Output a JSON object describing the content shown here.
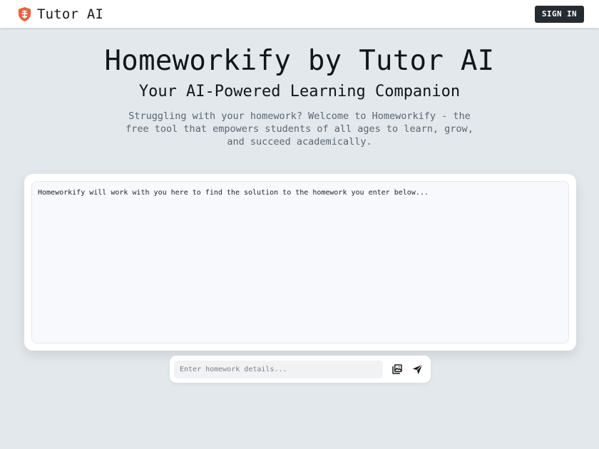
{
  "navbar": {
    "brand_name": "Tutor AI",
    "brand_icon": "shield-logo-icon",
    "brand_color": "#e4633f",
    "signin_label": "SIGN IN"
  },
  "hero": {
    "title": "Homeworkify by Tutor AI",
    "subtitle": "Your AI-Powered Learning Companion",
    "description": "Struggling with your homework? Welcome to Homeworkify - the free tool that empowers students of all ages to learn, grow, and succeed academically."
  },
  "chat": {
    "messages": [
      "Homeworkify will work with you here to find the solution to the homework you enter below..."
    ]
  },
  "composer": {
    "placeholder": "Enter homework details...",
    "value": "",
    "upload_icon": "image-upload-icon",
    "send_icon": "send-icon"
  },
  "colors": {
    "page_background": "#e2e8eb",
    "button_dark": "#262b31"
  }
}
